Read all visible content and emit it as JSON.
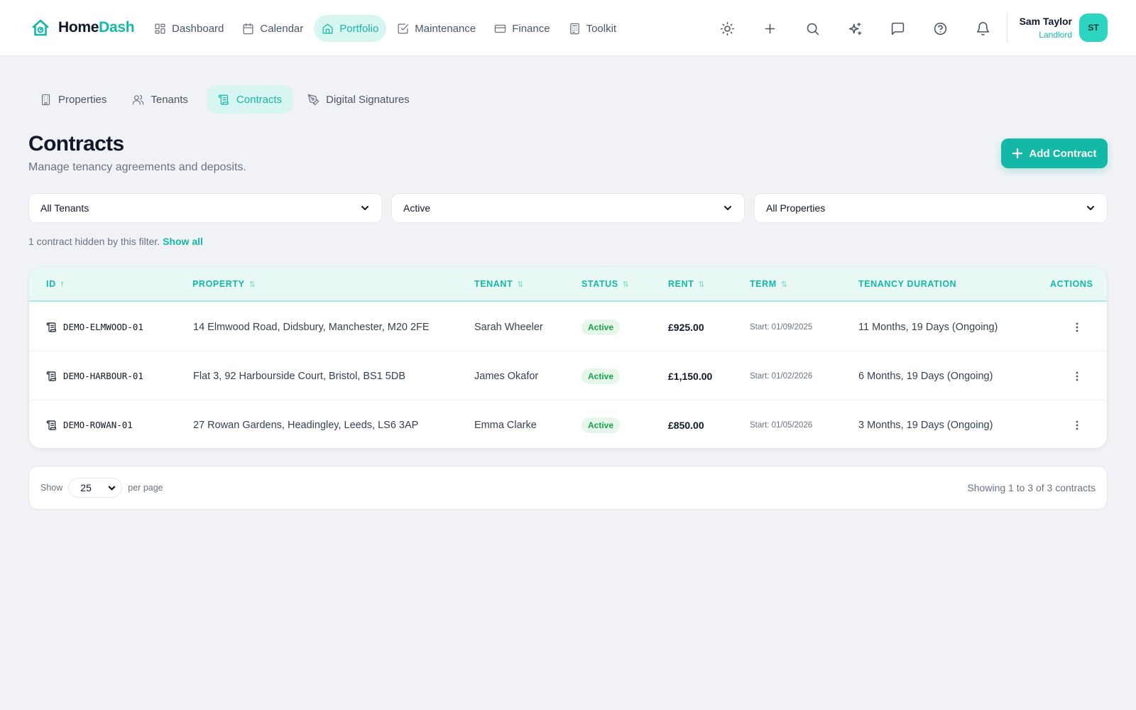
{
  "app": {
    "name_part1": "Home",
    "name_part2": "Dash",
    "accent_color": "#14b8a6"
  },
  "nav": {
    "items": [
      {
        "label": "Dashboard",
        "icon": "grid-icon"
      },
      {
        "label": "Calendar",
        "icon": "calendar-icon"
      },
      {
        "label": "Portfolio",
        "icon": "home-icon",
        "active": true
      },
      {
        "label": "Maintenance",
        "icon": "check-square-icon"
      },
      {
        "label": "Finance",
        "icon": "credit-card-icon"
      },
      {
        "label": "Toolkit",
        "icon": "calculator-icon"
      }
    ]
  },
  "toolbar": {
    "icons": [
      "sun-icon",
      "plus-icon",
      "search-icon",
      "sparkles-icon",
      "message-icon",
      "help-icon",
      "bell-icon"
    ]
  },
  "user": {
    "name": "Sam Taylor",
    "role": "Landlord",
    "initials": "ST"
  },
  "subtabs": [
    {
      "label": "Properties",
      "icon": "building-icon"
    },
    {
      "label": "Tenants",
      "icon": "users-icon"
    },
    {
      "label": "Contracts",
      "icon": "scroll-icon",
      "active": true
    },
    {
      "label": "Digital Signatures",
      "icon": "pen-tool-icon"
    }
  ],
  "page": {
    "title": "Contracts",
    "subtitle": "Manage tenancy agreements and deposits.",
    "add_button": "Add Contract"
  },
  "filters": {
    "tenant": "All Tenants",
    "status": "Active",
    "property": "All Properties",
    "note": "1 contract hidden by this filter.",
    "note_link": "Show all"
  },
  "table": {
    "headers": {
      "id": "ID",
      "property": "PROPERTY",
      "tenant": "TENANT",
      "status": "STATUS",
      "rent": "RENT",
      "term": "TERM",
      "duration": "TENANCY DURATION",
      "actions": "ACTIONS"
    },
    "rows": [
      {
        "id": "DEMO-ELMWOOD-01",
        "property": "14 Elmwood Road, Didsbury, Manchester, M20 2FE",
        "tenant": "Sarah Wheeler",
        "status": "Active",
        "rent": "£925.00",
        "term": "Start: 01/09/2025",
        "duration": "11 Months, 19 Days (Ongoing)"
      },
      {
        "id": "DEMO-HARBOUR-01",
        "property": "Flat 3, 92 Harbourside Court, Bristol, BS1 5DB",
        "tenant": "James Okafor",
        "status": "Active",
        "rent": "£1,150.00",
        "term": "Start: 01/02/2026",
        "duration": "6 Months, 19 Days (Ongoing)"
      },
      {
        "id": "DEMO-ROWAN-01",
        "property": "27 Rowan Gardens, Headingley, Leeds, LS6 3AP",
        "tenant": "Emma Clarke",
        "status": "Active",
        "rent": "£850.00",
        "term": "Start: 01/05/2026",
        "duration": "3 Months, 19 Days (Ongoing)"
      }
    ]
  },
  "pagination": {
    "show_label": "Show",
    "per_page_value": "25",
    "per_page_label": "per page",
    "summary": "Showing 1 to 3 of 3 contracts"
  }
}
